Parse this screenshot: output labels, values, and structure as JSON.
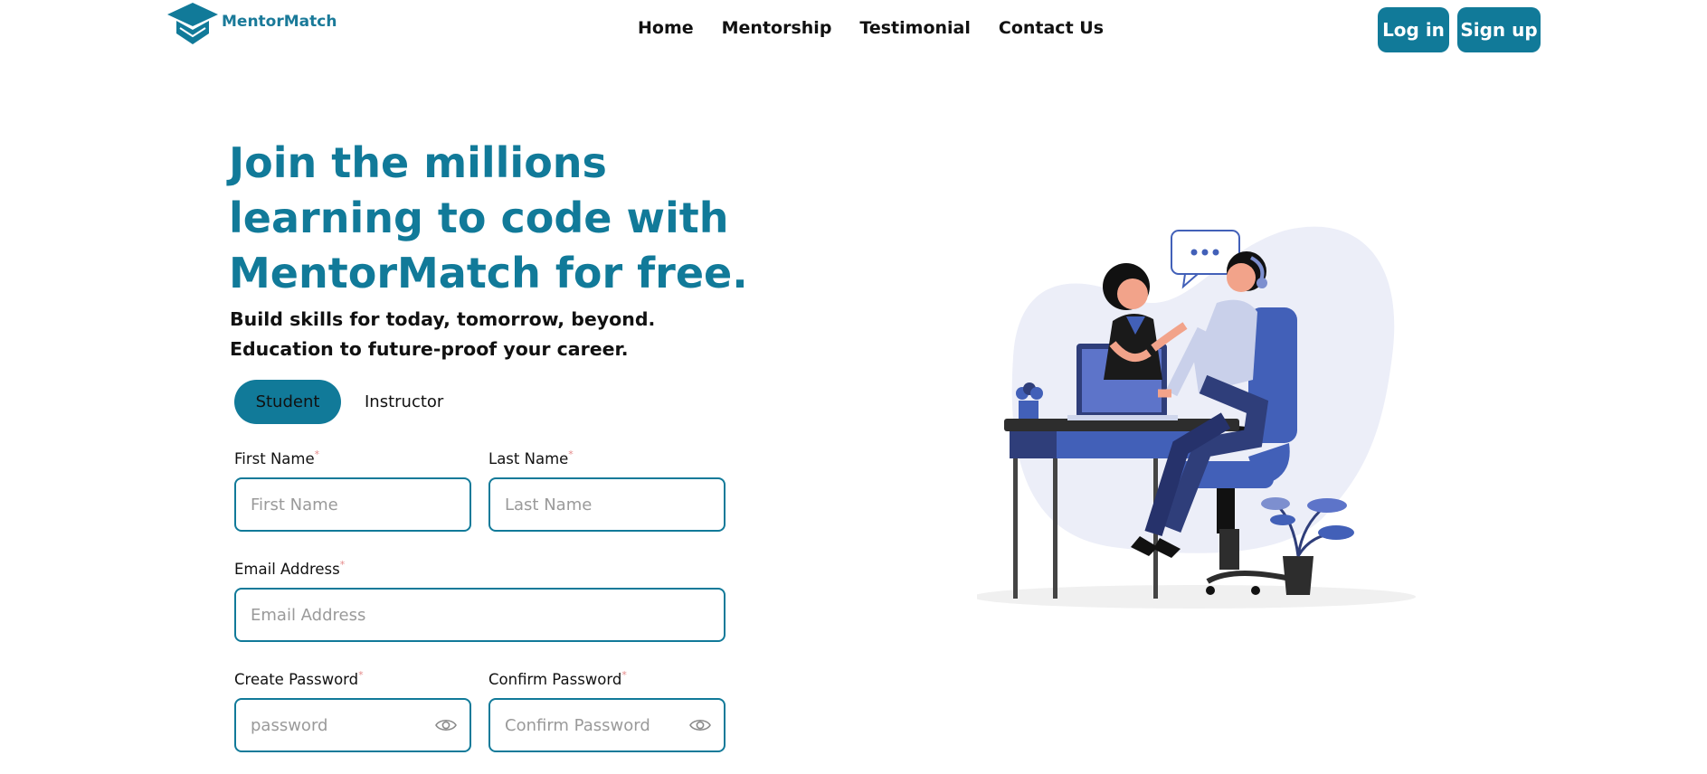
{
  "brand": {
    "name": "MentorMatch"
  },
  "nav": {
    "items": [
      "Home",
      "Mentorship",
      "Testimonial",
      "Contact Us"
    ]
  },
  "auth": {
    "login_label": "Log in",
    "signup_label": "Sign up"
  },
  "hero": {
    "title_lines": [
      "Join the millions",
      "learning to code with",
      "MentorMatch for free."
    ],
    "subtitle_lines": [
      "Build skills for today, tomorrow, beyond.",
      "Education to future-proof your career."
    ]
  },
  "role_tabs": {
    "student": "Student",
    "instructor": "Instructor",
    "selected": "Student"
  },
  "form": {
    "first_name": {
      "label": "First Name",
      "placeholder": "First Name",
      "value": ""
    },
    "last_name": {
      "label": "Last Name",
      "placeholder": "Last Name",
      "value": ""
    },
    "email": {
      "label": "Email Address",
      "placeholder": "Email Address",
      "value": ""
    },
    "password": {
      "label": "Create Password",
      "placeholder": "password",
      "value": ""
    },
    "confirm_password": {
      "label": "Confirm Password",
      "placeholder": "Confirm Password",
      "value": ""
    },
    "required_mark": "*"
  },
  "colors": {
    "primary": "#117a99",
    "illustration_blue": "#4260b8",
    "blob": "#eceef8"
  },
  "icons": {
    "logo": "graduation-cap-icon",
    "password_toggle": "eye-icon"
  }
}
